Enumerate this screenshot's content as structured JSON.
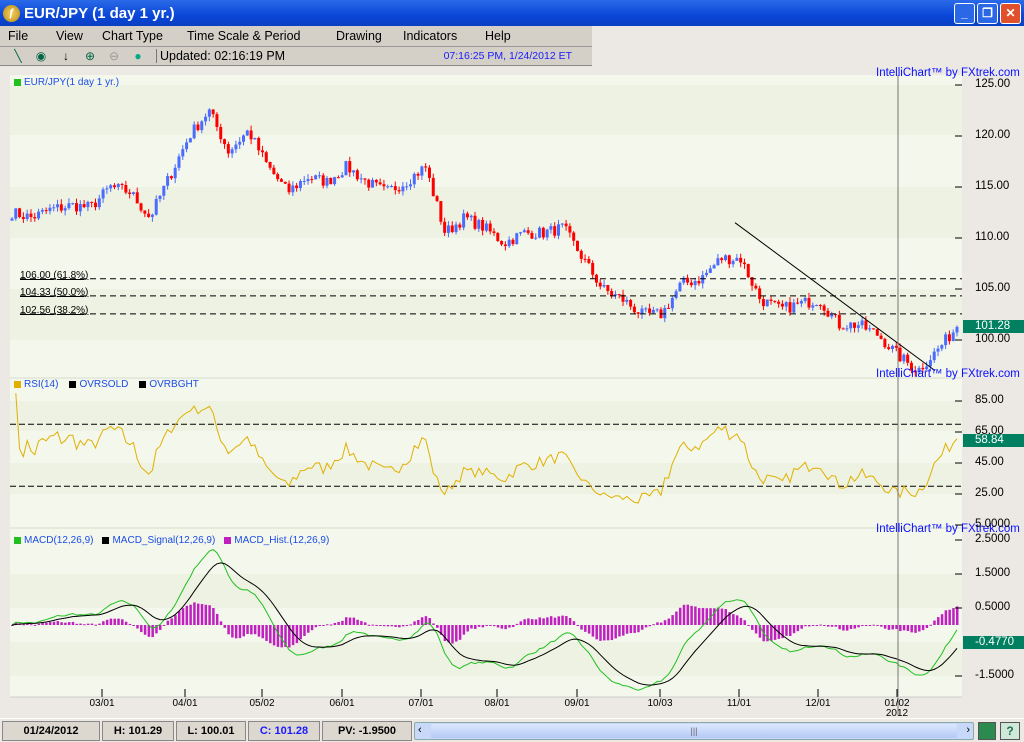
{
  "window": {
    "title": "EUR/JPY (1 day  1 yr.)",
    "minimize": "_",
    "restore": "❐",
    "close": "✕"
  },
  "menu": [
    "File",
    "View",
    "Chart Type",
    "Time Scale & Period",
    "Drawing",
    "Indicators",
    "Help"
  ],
  "toolbar": {
    "updated": "Updated: 02:16:19 PM",
    "clock": "07:16:25 PM, 1/24/2012 ET"
  },
  "watermark": "IntelliChart™ by FXtrek.com",
  "panels": {
    "price": {
      "legend": "EUR/JPY(1 day  1 yr.)",
      "ticks": [
        "125.00",
        "120.00",
        "115.00",
        "110.00",
        "105.00",
        "100.00"
      ],
      "tick_values": [
        125,
        120,
        115,
        110,
        105,
        100
      ],
      "last": "101.28",
      "color_up": "#4a6cff",
      "color_down": "#ff0000",
      "fib": [
        {
          "label": "106.00 (61.8%)",
          "value": 106.0
        },
        {
          "label": "104.33 (50.0%)",
          "value": 104.33
        },
        {
          "label": "102.56 (38.2%)",
          "value": 102.56
        }
      ]
    },
    "rsi": {
      "legends": [
        "RSI(14)",
        "OVRSOLD",
        "OVRBGHT"
      ],
      "ticks": [
        "85.00",
        "65.00",
        "45.00",
        "25.00",
        "5.0000"
      ],
      "tick_values": [
        85,
        65,
        45,
        25,
        5
      ],
      "last": "58.84",
      "overbought": 70,
      "oversold": 30,
      "color": "#e0b000"
    },
    "macd": {
      "legends": [
        "MACD(12,26,9)",
        "MACD_Signal(12,26,9)",
        "MACD_Hist.(12,26,9)"
      ],
      "ticks": [
        "2.5000",
        "1.5000",
        "0.5000",
        "-1.5000"
      ],
      "tick_values": [
        2.5,
        1.5,
        0.5,
        -1.5
      ],
      "last": "-0.4770"
    }
  },
  "xaxis": {
    "labels": [
      "03/01",
      "04/01",
      "05/02",
      "06/01",
      "07/01",
      "08/01",
      "09/01",
      "10/03",
      "11/01",
      "12/01",
      "01/02"
    ],
    "year": "2012"
  },
  "status": {
    "date": "01/24/2012",
    "high": "H: 101.29",
    "low": "L: 100.01",
    "close": "C: 101.28",
    "pv": "PV: -1.9500"
  },
  "chart_data": {
    "type": "candlestick",
    "title": "EUR/JPY (1 day 1 yr.)",
    "ylim": [
      97,
      125
    ],
    "approx_closes": [
      112.5,
      112,
      112.8,
      113.2,
      113,
      115,
      114.5,
      112,
      116,
      120,
      122.5,
      118.5,
      120.5,
      117,
      114.5,
      116,
      115.5,
      117,
      115.5,
      114.5,
      115.5,
      117,
      110.5,
      112,
      111,
      109.5,
      110.5,
      110.5,
      111,
      108,
      105,
      104,
      102.5,
      102.5,
      105.5,
      106,
      108,
      108,
      104,
      103,
      103.5,
      104,
      101.5,
      101.5,
      100.5,
      98.5,
      97,
      99,
      101.28
    ],
    "trendline": {
      "from": 111.5,
      "to": 97
    }
  }
}
